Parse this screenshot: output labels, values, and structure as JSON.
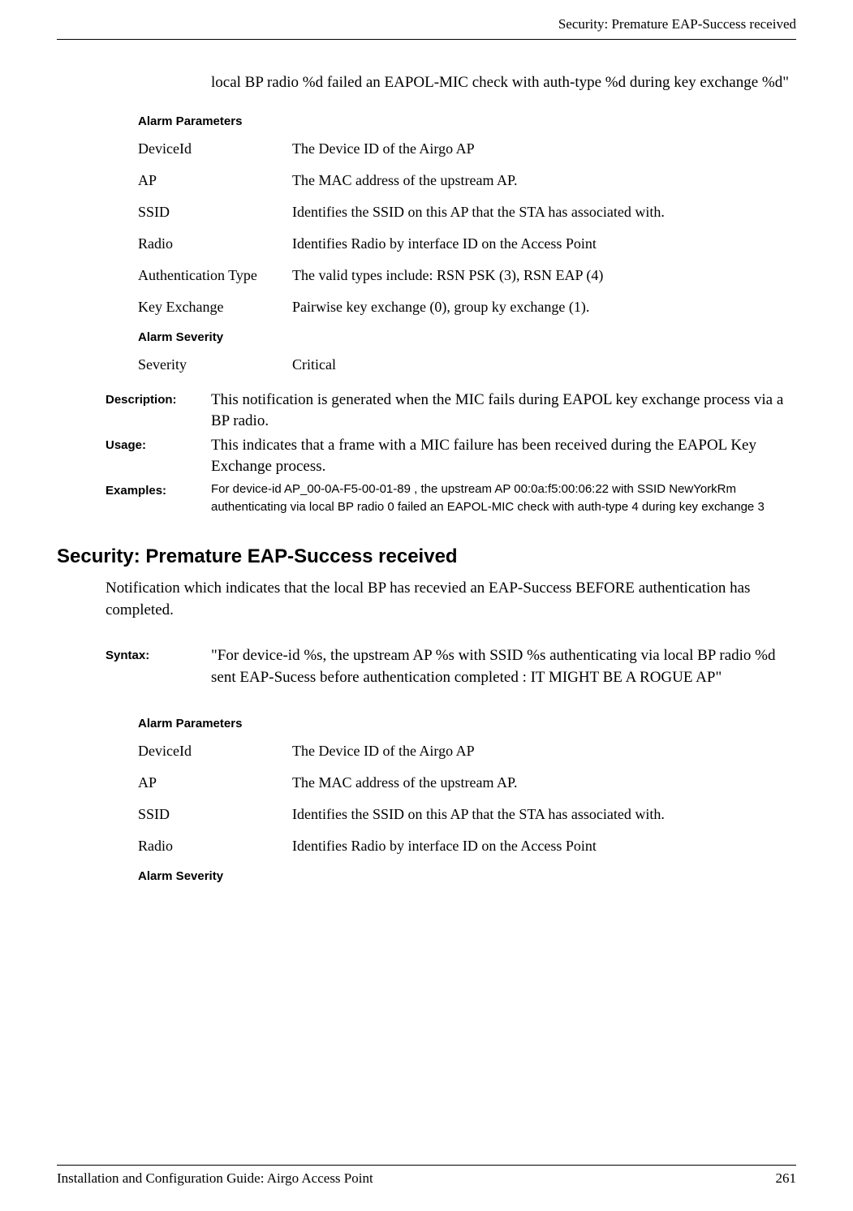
{
  "header": {
    "title": "Security: Premature EAP-Success received"
  },
  "topContent": "local BP radio %d failed an EAPOL-MIC check with auth-type %d during key exchange %d\"",
  "alarmParams1": {
    "heading": "Alarm Parameters",
    "rows": [
      {
        "name": "DeviceId",
        "desc": "The Device ID of the Airgo AP"
      },
      {
        "name": "AP",
        "desc": "The MAC address of the upstream AP."
      },
      {
        "name": "SSID",
        "desc": "Identifies the SSID on this AP that the STA has associated with."
      },
      {
        "name": "Radio",
        "desc": "Identifies Radio by interface ID on the Access Point"
      },
      {
        "name": "Authentication Type",
        "desc": "The valid types include: RSN PSK (3), RSN EAP (4)"
      },
      {
        "name": "Key Exchange",
        "desc": "Pairwise key exchange (0), group ky exchange (1)."
      }
    ],
    "severityHeading": "Alarm Severity",
    "severityName": "Severity",
    "severityValue": "Critical"
  },
  "defs1": {
    "description": {
      "term": "Description:",
      "desc": "This notification is generated when the MIC fails during EAPOL key exchange process via a BP radio."
    },
    "usage": {
      "term": "Usage:",
      "desc": "This indicates that a frame with a MIC failure has been received during the EAPOL Key Exchange process."
    },
    "examples": {
      "term": "Examples:",
      "desc": "For device-id AP_00-0A-F5-00-01-89 , the upstream AP 00:0a:f5:00:06:22 with SSID NewYorkRm authenticating via local BP radio 0 failed an EAPOL-MIC check with auth-type 4 during key exchange 3"
    }
  },
  "section2": {
    "heading": "Security: Premature EAP-Success received",
    "intro": "Notification which indicates that the local BP has recevied an EAP-Success BEFORE authentication has completed.",
    "syntax": {
      "term": "Syntax:",
      "desc": "\"For device-id %s, the upstream AP %s with SSID %s authenticating via local BP radio %d sent EAP-Sucess before authentication completed : IT MIGHT BE A ROGUE AP\""
    }
  },
  "alarmParams2": {
    "heading": "Alarm Parameters",
    "rows": [
      {
        "name": "DeviceId",
        "desc": "The Device ID of the Airgo AP"
      },
      {
        "name": "AP",
        "desc": "The MAC address of the upstream AP."
      },
      {
        "name": "SSID",
        "desc": "Identifies the SSID on this AP that the STA has associated with."
      },
      {
        "name": "Radio",
        "desc": "Identifies Radio by interface ID on the Access Point"
      }
    ],
    "severityHeading": "Alarm Severity"
  },
  "footer": {
    "left": "Installation and Configuration Guide: Airgo Access Point",
    "right": "261"
  }
}
